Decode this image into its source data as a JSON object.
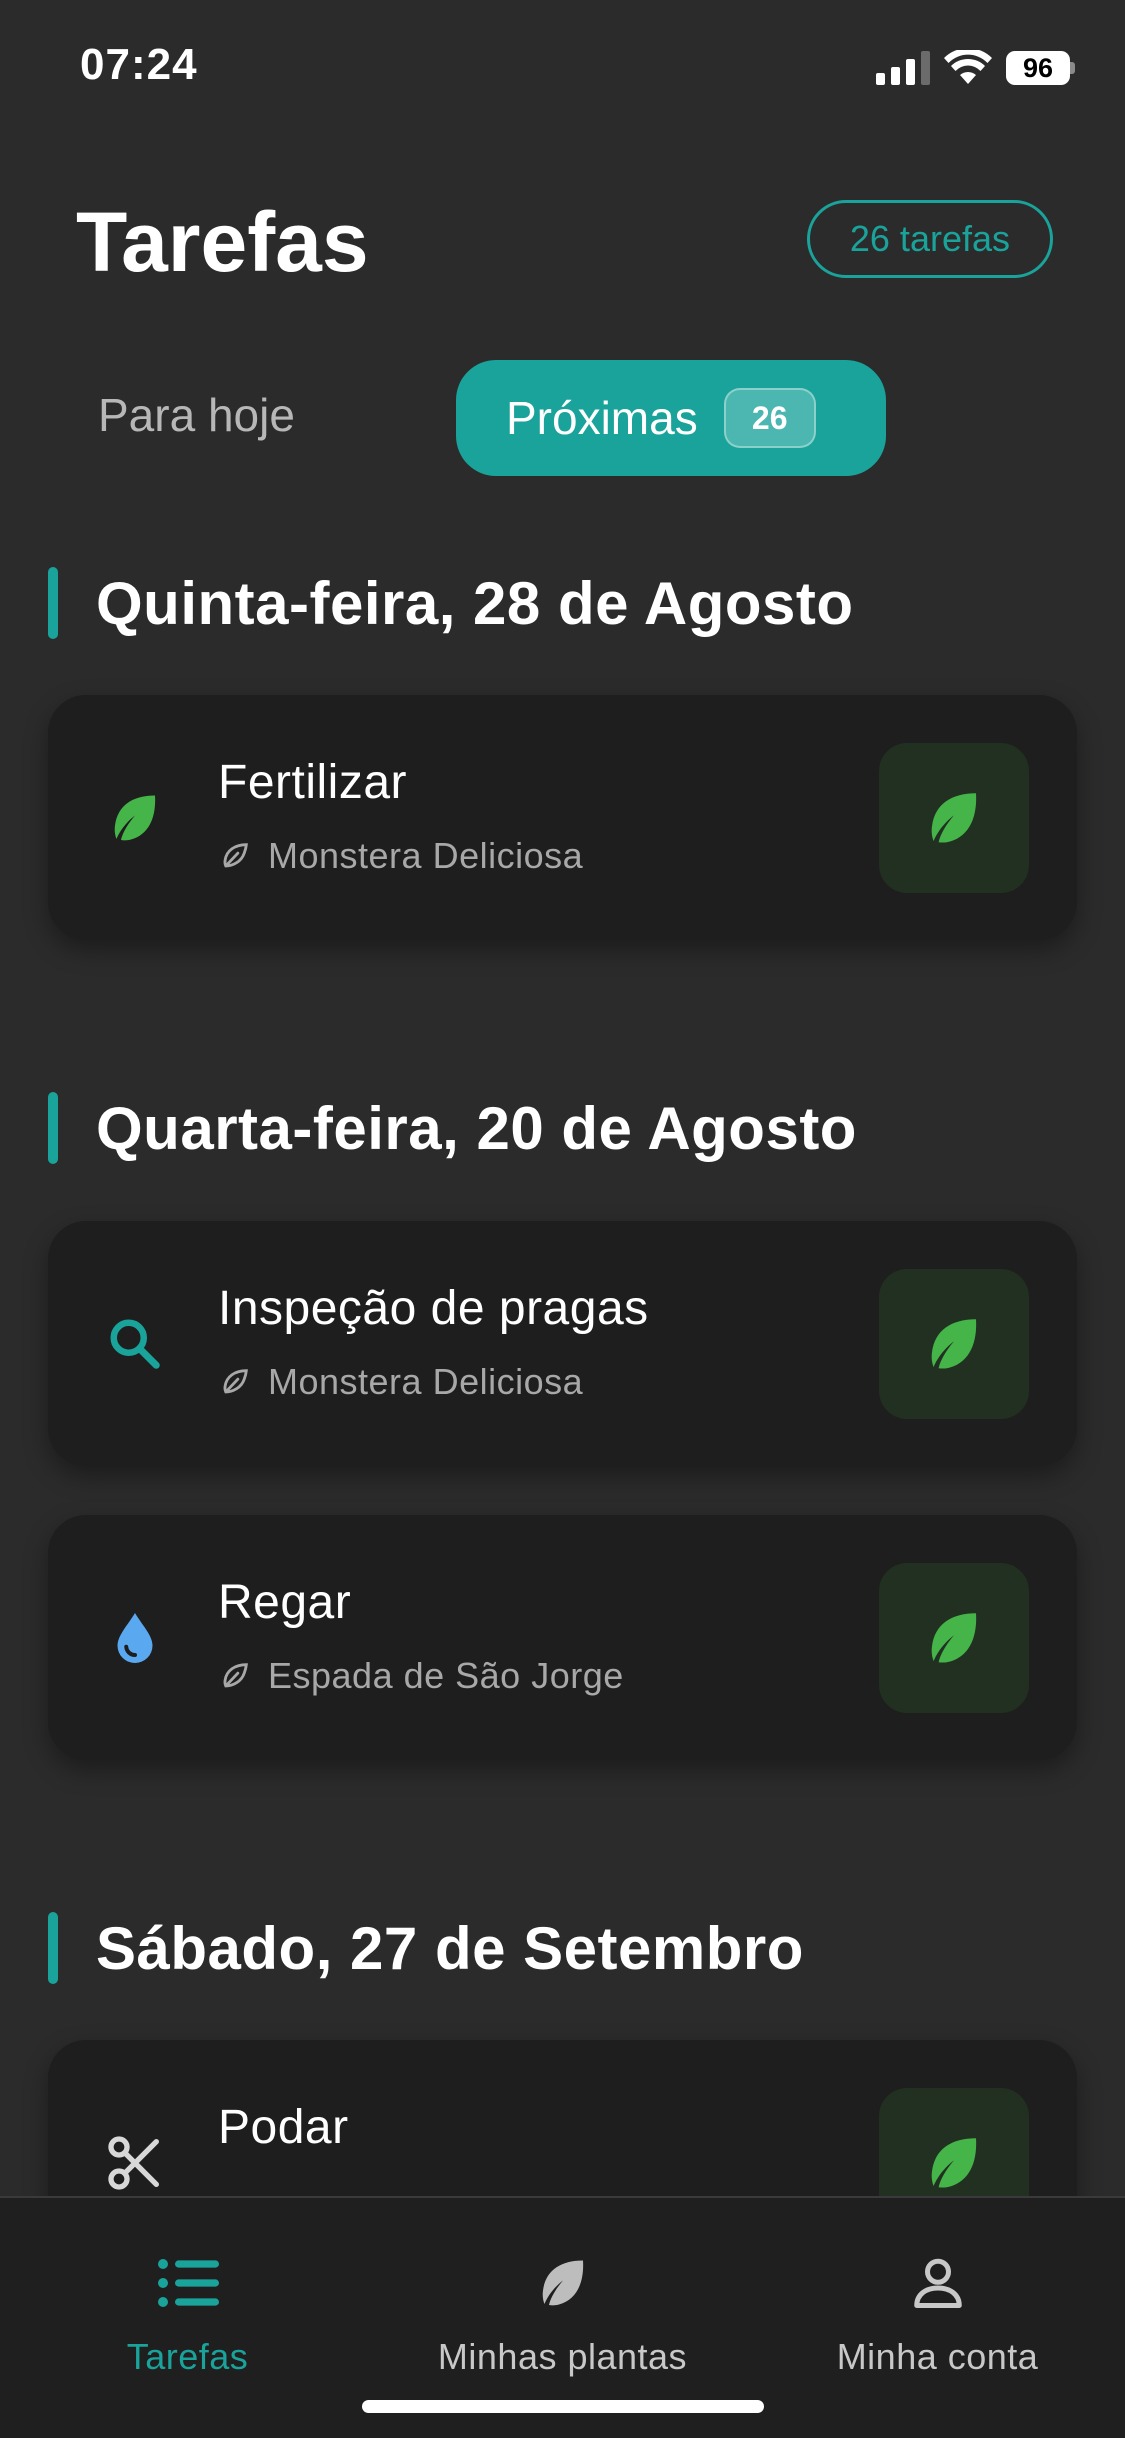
{
  "status_bar": {
    "time": "07:24",
    "battery": "96"
  },
  "header": {
    "title": "Tarefas",
    "count_pill": "26 tarefas"
  },
  "tabs": {
    "today_label": "Para hoje",
    "next_label": "Próximas",
    "next_badge": "26"
  },
  "sections": [
    {
      "title": "Quinta-feira, 28 de Agosto",
      "tasks": [
        {
          "title": "Fertilizar",
          "plant": "Monstera Deliciosa",
          "icon": "leaf-icon"
        }
      ]
    },
    {
      "title": "Quarta-feira, 20 de Agosto",
      "tasks": [
        {
          "title": "Inspeção de pragas",
          "plant": "Monstera Deliciosa",
          "icon": "search-icon"
        },
        {
          "title": "Regar",
          "plant": "Espada de São Jorge",
          "icon": "water-drop-icon"
        }
      ]
    },
    {
      "title": "Sábado, 27 de Setembro",
      "tasks": [
        {
          "title": "Podar",
          "plant": "",
          "icon": "scissors-icon"
        }
      ]
    }
  ],
  "bottom_nav": {
    "tasks": "Tarefas",
    "plants": "Minhas plantas",
    "account": "Minha conta"
  },
  "colors": {
    "accent": "#1aa39a",
    "background": "#2b2b2c",
    "card": "#1e1e1e",
    "leaf_green": "#45b449",
    "water_blue": "#5aa9f0"
  }
}
